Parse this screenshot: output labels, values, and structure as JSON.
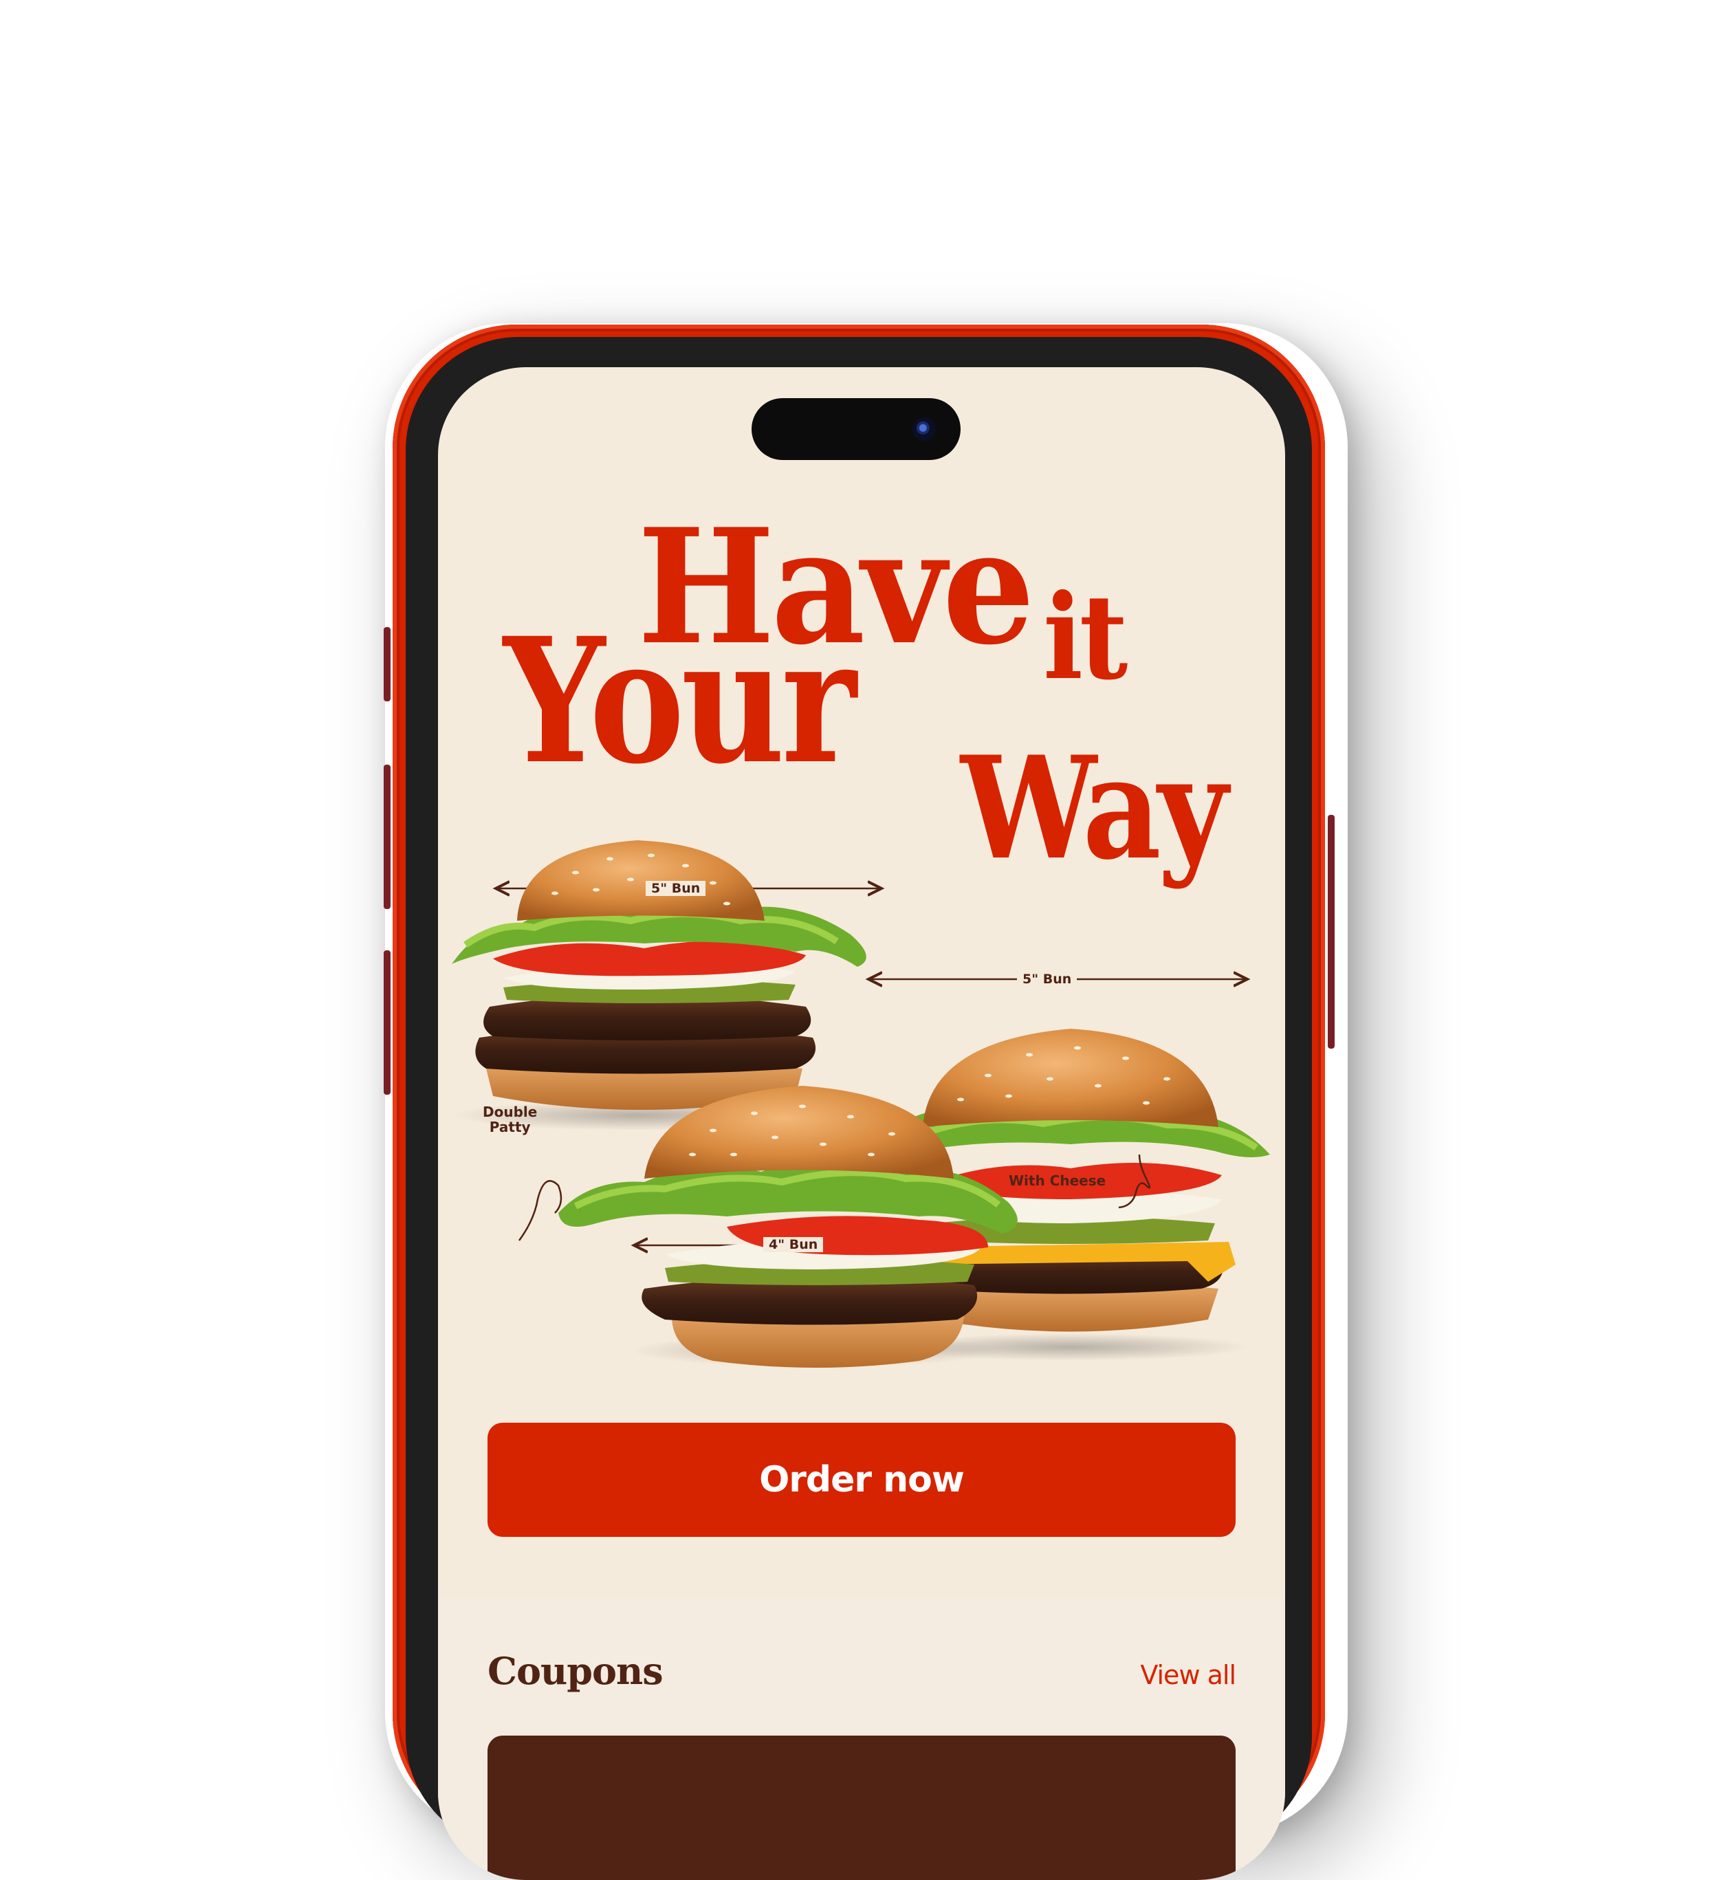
{
  "app": {
    "brand_color": "#d62300",
    "brown": "#502314",
    "cream": "#f5ebdc"
  },
  "hero": {
    "headline_have": "Have",
    "headline_it": "it",
    "headline_your": "Your",
    "headline_way": "Way"
  },
  "burgers": {
    "top_left_bun_label": "5\" Bun",
    "right_bun_label": "5\" Bun",
    "bottom_bun_label": "4\" Bun",
    "double_patty_callout": "Double\nPatty",
    "cheese_callout": "With Cheese"
  },
  "actions": {
    "order_button_label": "Order now"
  },
  "coupons": {
    "title": "Coupons",
    "view_all_label": "View all"
  }
}
